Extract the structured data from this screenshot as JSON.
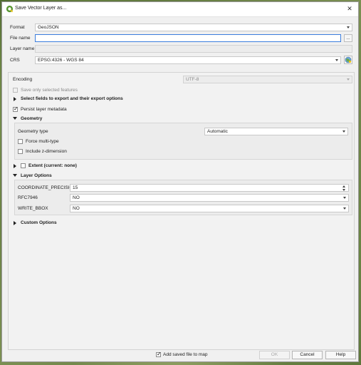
{
  "window": {
    "title": "Save Vector Layer as..."
  },
  "form": {
    "format_label": "Format",
    "format_value": "GeoJSON",
    "filename_label": "File name",
    "filename_value": "",
    "browse_label": "...",
    "layername_label": "Layer name",
    "layername_value": "",
    "crs_label": "CRS",
    "crs_value": "EPSG:4326 - WGS 84"
  },
  "options": {
    "encoding_label": "Encoding",
    "encoding_value": "UTF-8",
    "save_selected_label": "Save only selected features",
    "select_fields_label": "Select fields to export and their export options",
    "persist_metadata_label": "Persist layer metadata",
    "geometry_label": "Geometry",
    "geometry_type_label": "Geometry type",
    "geometry_type_value": "Automatic",
    "force_multi_label": "Force multi-type",
    "include_z_label": "Include z-dimension",
    "extent_label": "Extent (current: none)",
    "layer_options_label": "Layer Options",
    "coord_precision_label": "COORDINATE_PRECISION",
    "coord_precision_value": "15",
    "rfc7946_label": "RFC7946",
    "rfc7946_value": "NO",
    "write_bbox_label": "WRITE_BBOX",
    "write_bbox_value": "NO",
    "custom_options_label": "Custom Options"
  },
  "footer": {
    "add_saved_label": "Add saved file to map",
    "ok_label": "OK",
    "cancel_label": "Cancel",
    "help_label": "Help"
  },
  "colors": {
    "accent": "#3b7ddd",
    "qgis_green": "#589632",
    "qgis_yellow": "#f0c419"
  }
}
